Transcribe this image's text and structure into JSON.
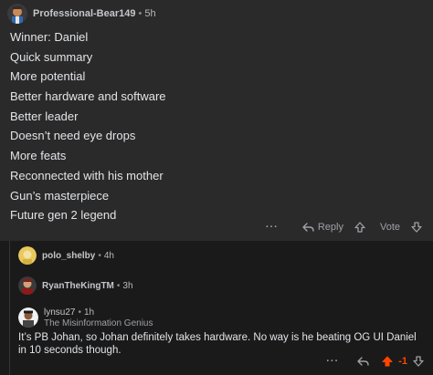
{
  "comment": {
    "author": "Professional-Bear149",
    "age": "5h",
    "lines": [
      "Winner: Daniel",
      "Quick summary",
      "More potential",
      "Better hardware and software",
      "Better leader",
      "Doesn’t need eye drops",
      "More feats",
      "Reconnected with his mother",
      "Gun’s masterpiece",
      "Future gen 2 legend"
    ],
    "more_label": "···",
    "reply_label": "Reply",
    "vote_label": "Vote"
  },
  "replies": [
    {
      "author": "polo_shelby",
      "age": "4h"
    },
    {
      "author": "RyanTheKingTM",
      "age": "3h"
    },
    {
      "author": "lynsu27",
      "age": "1h",
      "flair": "The Misinformation Genius",
      "body": "It’s PB Johan, so Johan definitely takes hardware. No way is he beating OG UI Daniel in 10 seconds though.",
      "score": "-1",
      "more_label": "···"
    }
  ],
  "colors": {
    "card_bg": "#2a2a2b",
    "page_bg": "#1a1a1b",
    "upvote_active": "#ff4500",
    "meta_text": "#b7b9bc"
  }
}
